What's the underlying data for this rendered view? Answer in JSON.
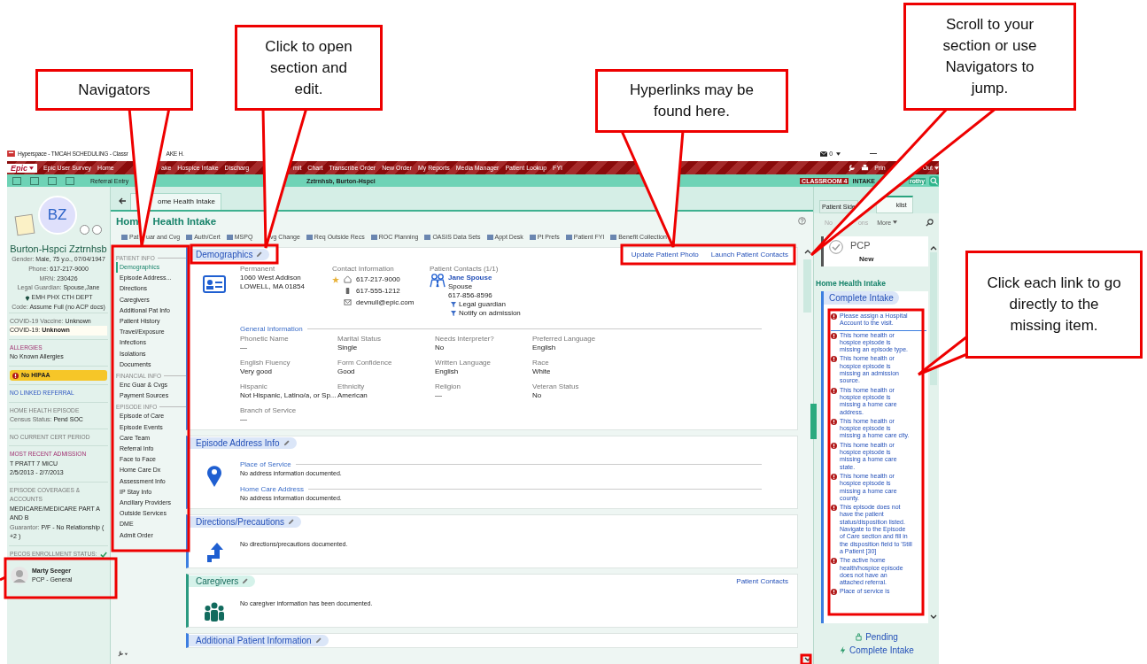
{
  "window": {
    "title_parts": [
      "Hyperspace - TMCAH SCHEDULING - Classr",
      "AKE H."
    ],
    "mail_count": "0"
  },
  "menu_bar": {
    "logo": "Epic",
    "items": [
      {
        "label": "Epic User Survey"
      },
      {
        "label": "Home"
      },
      {
        "label": "ake"
      },
      {
        "label": "Hospice Intake"
      },
      {
        "label": "Discharg"
      },
      {
        "label": "mit"
      },
      {
        "label": "Chart"
      },
      {
        "label": "Transcribe Order"
      },
      {
        "label": "New Order"
      },
      {
        "label": "My Reports"
      },
      {
        "label": "Media Manager"
      },
      {
        "label": "Patient Lookup"
      },
      {
        "label": "FYI"
      }
    ],
    "right_parts": [
      "Prin",
      "Out"
    ]
  },
  "toolbar": {
    "activity": "Referral Entry",
    "patient": "Zztrnhsb, Burton-Hspci",
    "environment": "CLASSROOM 4",
    "role": "INTAKE",
    "user": "rothy"
  },
  "patient": {
    "initials": "BZ",
    "name": "Burton-Hspci Zztrnhsb",
    "fields": [
      {
        "label": "Gender:",
        "value": "Male, 75 y.o., 07/04/1947"
      },
      {
        "label": "Phone:",
        "value": "617-217-9000"
      },
      {
        "label": "MRN:",
        "value": "230426"
      },
      {
        "label": "Legal Guardian:",
        "value": "Spouse,Jane"
      }
    ],
    "department": "EMH PHX CTH DEPT",
    "code": {
      "label": "Code:",
      "value": "Assume Full (no ACP docs)"
    }
  },
  "sidebar_blocks": [
    {
      "lines": [
        {
          "kind": "field",
          "label": "COVID-19 Vaccine:",
          "value": "Unknown"
        },
        {
          "kind": "warning",
          "label": "COVID-19:",
          "value": "Unknown"
        }
      ]
    },
    {
      "header": "ALLERGIES",
      "kind": "accent",
      "lines": [
        {
          "kind": "text",
          "text": "No Known Allergies"
        }
      ]
    },
    {
      "lines": [
        {
          "kind": "alert",
          "text": "No HIPAA"
        }
      ]
    },
    {
      "header": "NO LINKED REFERRAL",
      "kind": "link"
    },
    {
      "header": "HOME HEALTH EPISODE",
      "kind": "muted",
      "lines": [
        {
          "kind": "field",
          "label": "Census Status:",
          "value": "Pend SOC"
        }
      ]
    },
    {
      "header": "NO CURRENT CERT PERIOD",
      "kind": "muted"
    },
    {
      "header": "MOST RECENT ADMISSION",
      "kind": "accent",
      "lines": [
        {
          "kind": "text",
          "text": "T PRATT 7 MICU"
        },
        {
          "kind": "text",
          "text": "2/5/2013 - 2/7/2013"
        }
      ]
    },
    {
      "header": "EPISODE COVERAGES & ACCOUNTS",
      "kind": "muted",
      "lines": [
        {
          "kind": "text",
          "text": "MEDICARE/MEDICARE PART A AND B"
        },
        {
          "kind": "field",
          "label": "Guarantor:",
          "value": "P/F - No Relationship ( +2 )"
        }
      ]
    },
    {
      "header": "PECOS ENROLLMENT STATUS:",
      "kind": "muted",
      "check": true
    }
  ],
  "pcp": {
    "name": "Marty Seeger",
    "role": "PCP - General"
  },
  "activity_tab": "ome Health Intake",
  "activity": {
    "title_parts": [
      "Hom",
      "Health Intake"
    ],
    "actions": [
      {
        "label": "Pat"
      },
      {
        "label": "uar and Cvg"
      },
      {
        "label": "Auth/Cert"
      },
      {
        "label": "MSPQ"
      },
      {
        "label": "vg Change"
      },
      {
        "label": "Req Outside Recs"
      },
      {
        "label": "ROC Planning"
      },
      {
        "label": "OASIS Data Sets"
      },
      {
        "label": "Appt Desk"
      },
      {
        "label": "Pt Prefs"
      },
      {
        "label": "Patient FYI"
      },
      {
        "label": "Benefit Collection"
      }
    ]
  },
  "navigator": [
    {
      "header": "PATIENT INFO",
      "items": [
        {
          "label": "Demographics",
          "selected": true
        },
        {
          "label": "Episode Address...",
          "selected": false
        },
        {
          "label": "Directions",
          "selected": false
        },
        {
          "label": "Caregivers",
          "selected": false
        },
        {
          "label": "Additional Pat Info",
          "selected": false
        },
        {
          "label": "Patient History",
          "selected": false
        },
        {
          "label": "Travel/Exposure",
          "selected": false
        },
        {
          "label": "Infections",
          "selected": false
        },
        {
          "label": "Isolations",
          "selected": false
        },
        {
          "label": "Documents",
          "selected": false
        }
      ]
    },
    {
      "header": "FINANCIAL INFO",
      "items": [
        {
          "label": "Enc Guar & Cvgs",
          "selected": false
        },
        {
          "label": "Payment Sources",
          "selected": false
        }
      ]
    },
    {
      "header": "EPISODE INFO",
      "items": [
        {
          "label": "Episode of Care",
          "selected": false
        },
        {
          "label": "Episode Events",
          "selected": false
        },
        {
          "label": "Care Team",
          "selected": false
        },
        {
          "label": "Referral Info",
          "selected": false
        },
        {
          "label": "Face to Face",
          "selected": false
        },
        {
          "label": "Home Care Dx",
          "selected": false
        },
        {
          "label": "Assessment Info",
          "selected": false
        },
        {
          "label": "IP Stay Info",
          "selected": false
        },
        {
          "label": "Ancillary Providers",
          "selected": false
        },
        {
          "label": "Outside Services",
          "selected": false
        },
        {
          "label": "DME",
          "selected": false
        },
        {
          "label": "Admit Order",
          "selected": false
        }
      ]
    }
  ],
  "sections": [
    {
      "kind": "demographics",
      "title": "Demographics",
      "links": [
        {
          "label": "Update Patient Photo"
        },
        {
          "label": "Launch Patient Contacts"
        }
      ],
      "address": {
        "label": "Permanent",
        "lines": [
          "1060 West Addison",
          "LOWELL, MA 01854"
        ]
      },
      "contact": {
        "label": "Contact Information",
        "items": [
          {
            "kind": "home",
            "text": "617-217-9000",
            "preferred": true
          },
          {
            "kind": "mobile",
            "text": "617-555-1212",
            "preferred": false
          },
          {
            "kind": "email",
            "text": "devnull@epic.com",
            "preferred": false
          }
        ]
      },
      "patient_contacts": {
        "label": "Patient Contacts (1/1)",
        "name": "Jane Spouse",
        "relation": "Spouse",
        "phone": "617-856-8596",
        "flags": [
          "Legal guardian",
          "Notify on admission"
        ]
      },
      "general": {
        "title": "General Information",
        "fields": [
          {
            "label": "Phonetic Name",
            "value": "—"
          },
          {
            "label": "Marital Status",
            "value": "Single"
          },
          {
            "label": "Needs Interpreter?",
            "value": "No"
          },
          {
            "label": "Preferred Language",
            "value": "English"
          },
          {
            "label": "English Fluency",
            "value": "Very good"
          },
          {
            "label": "Form Confidence",
            "value": "Good"
          },
          {
            "label": "Written Language",
            "value": "English"
          },
          {
            "label": "Race",
            "value": "White"
          },
          {
            "label": "Hispanic",
            "value": "Not Hispanic, Latino/a, or Sp..."
          },
          {
            "label": "Ethnicity",
            "value": "American"
          },
          {
            "label": "Religion",
            "value": "—"
          },
          {
            "label": "Veteran Status",
            "value": "No"
          },
          {
            "label": "Branch of Service",
            "value": "—"
          }
        ]
      }
    },
    {
      "kind": "address",
      "title": "Episode Address Info",
      "subsections": [
        {
          "title": "Place of Service",
          "text": "No address information documented."
        },
        {
          "title": "Home Care Address",
          "text": "No address information documented."
        }
      ]
    },
    {
      "kind": "directions",
      "title": "Directions/Precautions",
      "text": "No directions/precautions documented."
    },
    {
      "kind": "caregivers",
      "title": "Caregivers",
      "text": "No caregiver information has been documented.",
      "links": [
        {
          "label": "Patient Contacts"
        }
      ]
    },
    {
      "kind": "additional",
      "title": "Additional Patient Information"
    }
  ],
  "side_panel": {
    "tabs": [
      {
        "label": "Patient Side",
        "selected": false
      },
      {
        "label": "klist",
        "selected": true
      }
    ],
    "toolbar_parts": [
      "No",
      "ons"
    ],
    "more": "More",
    "pcp_card": {
      "title": "PCP",
      "status": "New"
    },
    "heading": "Home Health Intake",
    "checklist": {
      "title": "Complete Intake",
      "items": [
        {
          "text": "Please assign a Hospital Account to the visit.",
          "selected": true
        },
        {
          "text": "This home health or hospice episode is missing an episode type.",
          "selected": false
        },
        {
          "text": "This home health or hospice episode is missing an admission source.",
          "selected": false
        },
        {
          "text": "This home health or hospice episode is missing a home care address.",
          "selected": false
        },
        {
          "text": "This home health or hospice episode is missing a home care city.",
          "selected": false
        },
        {
          "text": "This home health or hospice episode is missing a home care state.",
          "selected": false
        },
        {
          "text": "This home health or hospice episode is missing a home care county.",
          "selected": false
        },
        {
          "text": "This episode does not have the patient status/disposition listed. Navigate to the Episode of Care section and fill in the disposition field to 'Still a Patient [30]",
          "selected": false
        },
        {
          "text": "The active home health/hospice episode does not have an attached referral.",
          "selected": false
        },
        {
          "text": "Place of service is",
          "selected": false
        }
      ]
    },
    "actions": [
      {
        "kind": "pending",
        "label": "Pending"
      },
      {
        "kind": "complete",
        "label": "Complete Intake"
      }
    ]
  },
  "callouts": [
    {
      "text": "Navigators"
    },
    {
      "text": "Click to open section and edit."
    },
    {
      "text": "Hyperlinks may be found here."
    },
    {
      "text": "Scroll to your section or use Navigators to jump."
    },
    {
      "text": "Click each link to go directly to the missing item."
    }
  ]
}
